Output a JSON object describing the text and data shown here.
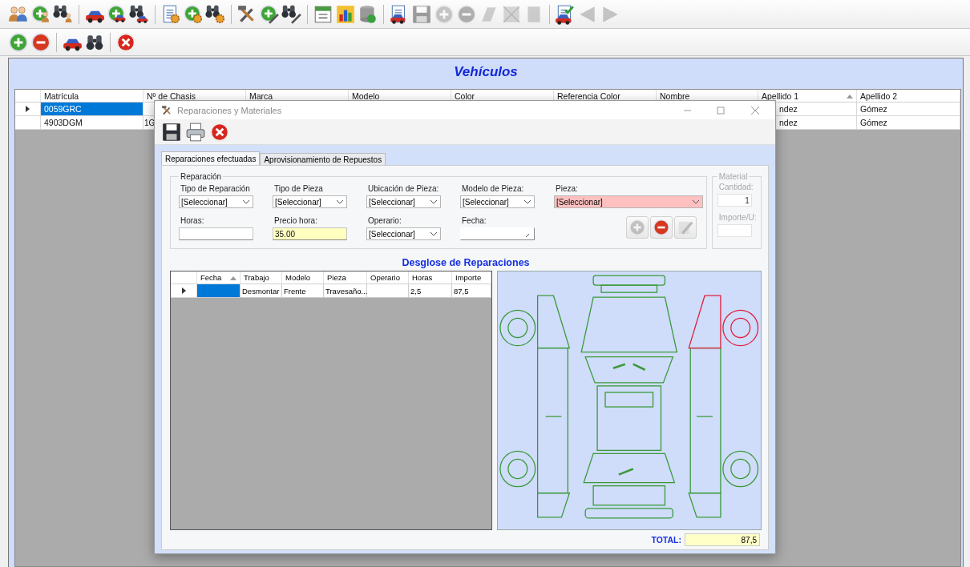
{
  "toolbar": {
    "groups": [
      {
        "items": [
          {
            "kind": "people",
            "disabled": false
          },
          {
            "kind": "add-people",
            "disabled": false
          },
          {
            "kind": "find-people",
            "disabled": false
          }
        ]
      },
      {
        "items": [
          {
            "kind": "car",
            "disabled": false
          },
          {
            "kind": "add-car",
            "disabled": false
          },
          {
            "kind": "find-car",
            "disabled": false
          }
        ]
      },
      {
        "items": [
          {
            "kind": "document",
            "disabled": false
          },
          {
            "kind": "add-gear",
            "disabled": false
          },
          {
            "kind": "find-gear",
            "disabled": false
          }
        ]
      },
      {
        "items": [
          {
            "kind": "tools",
            "disabled": false
          },
          {
            "kind": "add-tools",
            "disabled": false
          },
          {
            "kind": "find-tools",
            "disabled": false
          }
        ]
      },
      {
        "items": [
          {
            "kind": "calendar",
            "disabled": false
          },
          {
            "kind": "chart",
            "disabled": false
          },
          {
            "kind": "database",
            "disabled": false
          }
        ]
      },
      {
        "items": [
          {
            "kind": "car-document",
            "disabled": false
          },
          {
            "kind": "save",
            "disabled": true
          },
          {
            "kind": "add",
            "disabled": true
          },
          {
            "kind": "remove",
            "disabled": true
          },
          {
            "kind": "broken",
            "disabled": true
          },
          {
            "kind": "cross-box",
            "disabled": true
          },
          {
            "kind": "blank",
            "disabled": true
          }
        ]
      },
      {
        "items": [
          {
            "kind": "car-check",
            "disabled": false
          },
          {
            "kind": "arrow-left",
            "disabled": true
          },
          {
            "kind": "arrow-right",
            "disabled": true
          }
        ]
      }
    ]
  },
  "subtoolbar": {
    "groups": [
      {
        "items": [
          {
            "kind": "add",
            "disabled": false
          },
          {
            "kind": "remove",
            "disabled": false
          }
        ]
      },
      {
        "items": [
          {
            "kind": "car",
            "disabled": false
          },
          {
            "kind": "find",
            "disabled": false
          }
        ]
      },
      {
        "items": [
          {
            "kind": "close",
            "disabled": false
          }
        ]
      }
    ]
  },
  "panel": {
    "title": "Vehículos"
  },
  "table": {
    "columns": [
      {
        "label": "Matrícula",
        "sorted": false
      },
      {
        "label": "Nº de Chasis",
        "sorted": false
      },
      {
        "label": "Marca",
        "sorted": false
      },
      {
        "label": "Modelo",
        "sorted": false
      },
      {
        "label": "Color",
        "sorted": false
      },
      {
        "label": "Referencia Color",
        "sorted": false
      },
      {
        "label": "Nombre",
        "sorted": false
      },
      {
        "label": "Apellido 1",
        "sorted": true
      },
      {
        "label": "Apellido 2",
        "sorted": false
      }
    ],
    "rows": [
      {
        "current": true,
        "selected": true,
        "cells": [
          "0059GRC",
          null,
          null,
          null,
          null,
          null,
          null,
          "ndez",
          "Gómez"
        ]
      },
      {
        "current": false,
        "selected": false,
        "cells": [
          "4903DGM",
          "1G",
          null,
          null,
          null,
          null,
          null,
          "ndez",
          "Gómez"
        ]
      }
    ]
  },
  "dialog": {
    "title": "Reparaciones y Materiales",
    "toolbar": [
      {
        "kind": "save"
      },
      {
        "kind": "print"
      },
      {
        "kind": "close"
      }
    ],
    "tabs": [
      {
        "label": "Reparaciones efectuadas",
        "selected": true
      },
      {
        "label": "Aprovisionamiento de Repuestos",
        "selected": false
      }
    ],
    "repair_group": {
      "title": "Reparación",
      "rows": [
        {
          "fields": [
            {
              "kind": "combo",
              "label": "Tipo de Reparación",
              "value": "[Seleccionar]",
              "invalid": false,
              "highlighted": false
            },
            {
              "kind": "combo",
              "label": "Tipo de Pieza",
              "value": "[Seleccionar]",
              "invalid": false,
              "highlighted": false
            },
            {
              "kind": "combo",
              "label": "Ubicación de Pieza:",
              "value": "[Seleccionar]",
              "invalid": false,
              "highlighted": false
            },
            {
              "kind": "combo",
              "label": "Modelo de Pieza:",
              "value": "[Seleccionar]",
              "invalid": false,
              "highlighted": false
            },
            {
              "kind": "combo",
              "label": "Pieza:",
              "value": "[Seleccionar]",
              "invalid": true,
              "highlighted": false
            }
          ]
        },
        {
          "fields": [
            {
              "kind": "text",
              "label": "Horas:",
              "invalid": false,
              "highlighted": false
            },
            {
              "kind": "text",
              "label": "Precio hora:",
              "value": "35.00",
              "invalid": false,
              "highlighted": true
            },
            {
              "kind": "combo",
              "label": "Operario:",
              "value": "[Seleccionar]",
              "invalid": false,
              "highlighted": false
            },
            {
              "kind": "date",
              "label": "Fecha:"
            }
          ]
        }
      ],
      "actions": [
        {
          "kind": "add",
          "disabled": true
        },
        {
          "kind": "remove",
          "disabled": false
        },
        {
          "kind": "edit",
          "disabled": true
        }
      ]
    },
    "material_group": {
      "title": "Material",
      "disabled": true,
      "fields": [
        {
          "label": "Cantidad:",
          "value": "1"
        },
        {
          "label": "Importe/U:"
        }
      ]
    },
    "breakdown_title": "Desglose de Reparaciones",
    "grid": {
      "columns": [
        {
          "label": "Fecha",
          "sorted": true
        },
        {
          "label": "Trabajo",
          "sorted": false
        },
        {
          "label": "Modelo",
          "sorted": false
        },
        {
          "label": "Pieza",
          "sorted": false
        },
        {
          "label": "Operario",
          "sorted": false
        },
        {
          "label": "Horas",
          "sorted": false
        },
        {
          "label": "Importe",
          "sorted": false
        }
      ],
      "rows": [
        {
          "current": true,
          "cells": [
            "",
            "Desmontar",
            "Frente",
            "Travesaño...",
            "",
            "2,5",
            "87,5"
          ]
        }
      ]
    },
    "total": {
      "label": "TOTAL:",
      "value": "87,5"
    }
  }
}
